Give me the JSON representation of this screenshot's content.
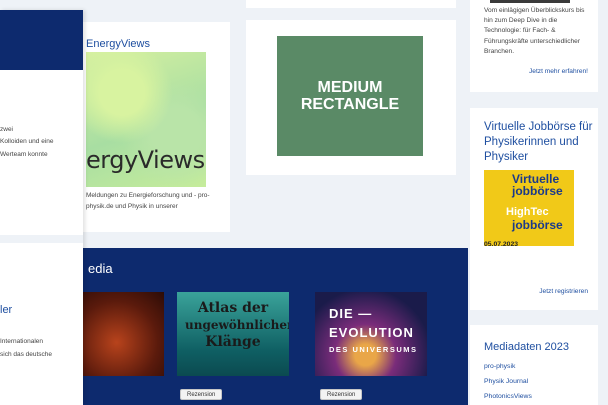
{
  "drawer": {
    "fragments": [
      "zwei",
      "Kolloiden und eine",
      "Werteam konnte"
    ],
    "link_fragment": "ler",
    "fragments_lower": [
      "Internationalen",
      "sich das deutsche"
    ]
  },
  "energyviews": {
    "title": "EnergyViews",
    "logo": "ergyViews",
    "description": "Meldungen zu Energieforschung und -  pro-physik.de und Physik in unserer"
  },
  "ad": {
    "label": "MEDIUM\nRECTANGLE",
    "color": "#5a8a66"
  },
  "course": {
    "text": "Vom einlägigen Überblickskurs bis hin zum Deep Dive in die Technologie: für Fach- & Führungskräfte unterschiedlicher Branchen.",
    "link": "Jetzt mehr erfahren!"
  },
  "jobboerse": {
    "title": "Virtuelle Jobbörse für Physikerinnen und Physiker",
    "img_lines": [
      "Virtuelle",
      "jobbörse",
      "HighTec",
      "jobbörse"
    ],
    "date": "05.07.2023",
    "link": "Jetzt registrieren"
  },
  "media": {
    "title": "edia",
    "tiles": [
      {
        "name": "tile-1"
      },
      {
        "name": "atlas",
        "line1": "Atlas der",
        "line2": "ungewöhnlichen",
        "line3": "Klänge",
        "button": "Rezension"
      },
      {
        "name": "evolution",
        "line1": "DIE —",
        "line2": "EVOLUTION",
        "line3": "DES UNIVERSUMS",
        "button": "Rezension"
      }
    ]
  },
  "mediadaten": {
    "title": "Mediadaten 2023",
    "links": [
      "pro-physik",
      "Physik Journal",
      "PhotonicsViews"
    ]
  },
  "colors": {
    "dark_blue": "#0d2a6e",
    "link_blue": "#1f4fa0",
    "background": "#eef2f7"
  }
}
